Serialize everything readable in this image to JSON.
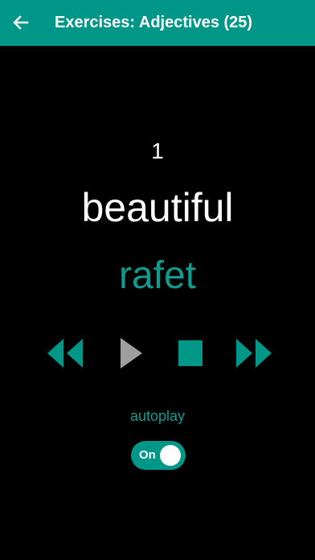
{
  "header": {
    "title": "Exercises: Adjectives (25)",
    "back_icon": "arrow-left-icon"
  },
  "card": {
    "index": "1",
    "word": "beautiful",
    "translation": "rafet"
  },
  "controls": {
    "rewind_icon": "rewind-icon",
    "play_icon": "play-icon",
    "stop_icon": "stop-icon",
    "forward_icon": "fast-forward-icon"
  },
  "autoplay": {
    "label": "autoplay",
    "toggle_text": "On",
    "enabled": true
  },
  "colors": {
    "accent": "#009688",
    "play_disabled": "#9e9e9e",
    "background": "#000000"
  }
}
